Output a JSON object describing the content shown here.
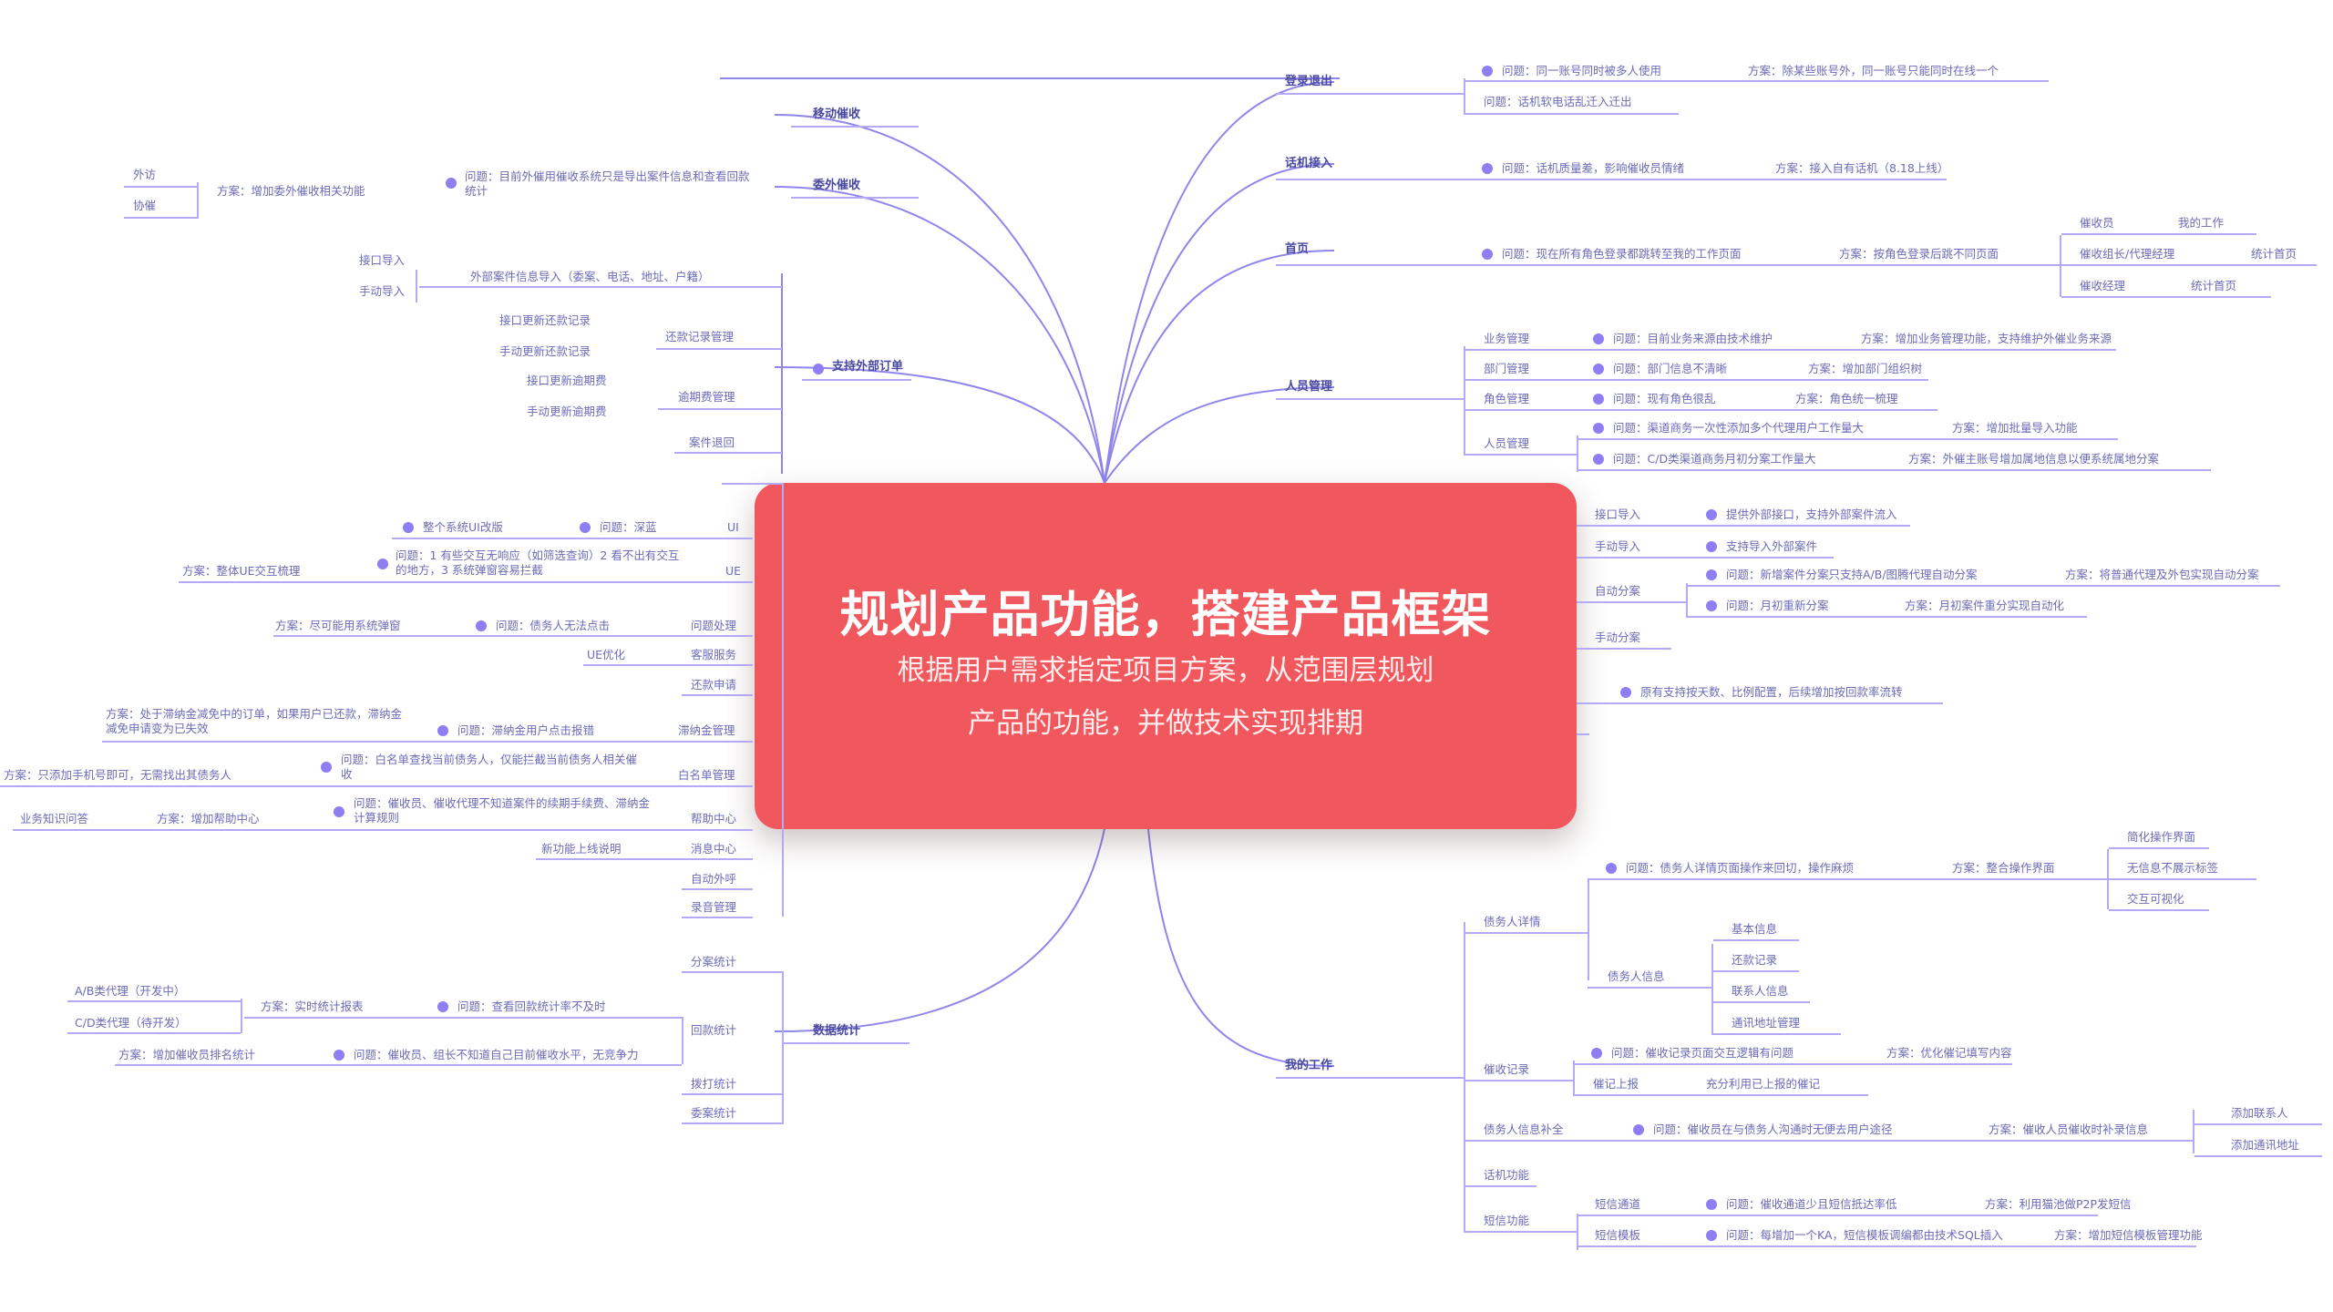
{
  "center": {
    "title": "规划产品功能，搭建产品框架",
    "subtitle_line1": "根据用户需求指定项目方案，从范围层规划",
    "subtitle_line2": "产品的功能，并做技术实现排期"
  },
  "left": {
    "mobile": "移动催收",
    "outsource": "委外催收",
    "outsource_problem": "问题：目前外催用催收系统只是导出案件信息和查看回款统计",
    "outsource_solution": "方案：增加委外催收相关功能",
    "visit": "外访",
    "assist": "协催",
    "external_order": "支持外部订单",
    "api_import": "接口导入",
    "manual_import": "手动导入",
    "case_import": "外部案件信息导入（委案、电话、地址、户籍）",
    "api_repay": "接口更新还款记录",
    "manual_repay": "手动更新还款记录",
    "repay_mgmt": "还款记录管理",
    "api_overdue": "接口更新逾期费",
    "manual_overdue": "手动更新逾期费",
    "overdue_mgmt": "逾期费管理",
    "case_return": "案件退回",
    "ui_revamp": "整个系统UI改版",
    "ui_problem": "问题：深蓝",
    "ui1": "UI",
    "ue_problem": "问题：1 有些交互无响应（如筛选查询）2 看不出有交互的地方，3 系统弹窗容易拦截",
    "ue_solution": "方案：整体UE交互梳理",
    "ue": "UE",
    "dispute_solution": "方案：尽可能用系统弹窗",
    "dispute_problem": "问题：债务人无法点击",
    "issue": "问题处理",
    "ue_opt": "UE优化",
    "cs": "客服服务",
    "repay_apply": "还款申请",
    "fee_solution": "方案：处于滞纳金减免中的订单，如果用户已还款，滞纳金减免申请变为已失效",
    "fee_problem": "问题：滞纳金用户点击报错",
    "fee_mgmt": "滞纳金管理",
    "white_solution": "方案：只添加手机号即可，无需找出其债务人",
    "white_problem": "问题：白名单查找当前债务人，仅能拦截当前债务人相关催收",
    "whitelist": "白名单管理",
    "kb": "业务知识问答",
    "help_solution": "方案：增加帮助中心",
    "help_problem": "问题：催收员、催收代理不知道案件的续期手续费、滞纳金计算规则",
    "help": "帮助中心",
    "newfeat": "新功能上线说明",
    "msg": "消息中心",
    "autocall": "自动外呼",
    "record": "录音管理",
    "datastat": "数据统计",
    "assign_stat": "分案统计",
    "ab": "A/B类代理（开发中）",
    "cd": "C/D类代理（待开发）",
    "realtime": "方案：实时统计报表",
    "refund_problem": "问题：查看回款统计率不及时",
    "refund_stat": "回款统计",
    "rank_solution": "方案：增加催收员排名统计",
    "rank_problem": "问题：催收员、组长不知道自己目前催收水平，无竞争力",
    "call_stat": "拨打统计",
    "commission_stat": "委案统计"
  },
  "right": {
    "login": "登录退出",
    "login_p1": "问题：同一账号同时被多人使用",
    "login_s1": "方案：除某些账号外，同一账号只能同时在线一个",
    "login_p2": "问题：话机软电话乱迁入迁出",
    "phone": "话机接入",
    "phone_p": "问题：话机质量差，影响催收员情绪",
    "phone_s": "方案：接入自有话机（8.18上线）",
    "home": "首页",
    "home_p": "问题：现在所有角色登录都跳转至我的工作页面",
    "home_s": "方案：按角色登录后跳不同页面",
    "r_collector": "催收员",
    "r_collector_v": "我的工作",
    "r_leader": "催收组长/代理经理",
    "r_leader_v": "统计首页",
    "r_manager": "催收经理",
    "r_manager_v": "统计首页",
    "staff": "人员管理",
    "biz": "业务管理",
    "biz_p": "问题：目前业务来源由技术维护",
    "biz_s": "方案：增加业务管理功能，支持维护外催业务来源",
    "dept": "部门管理",
    "dept_p": "问题：部门信息不清晰",
    "dept_s": "方案：增加部门组织树",
    "role": "角色管理",
    "role_p": "问题：现有角色很乱",
    "role_s": "方案：角色统一梳理",
    "people": "人员管理",
    "people_p1": "问题：渠道商务一次性添加多个代理用户工作量大",
    "people_s1": "方案：增加批量导入功能",
    "people_p2": "问题：C/D类渠道商务月初分案工作量大",
    "people_s2": "方案：外催主账号增加属地信息以便系统属地分案",
    "api_imp": "接口导入",
    "api_imp_v": "提供外部接口，支持外部案件流入",
    "man_imp": "手动导入",
    "man_imp_v": "支持导入外部案件",
    "auto_assign": "自动分案",
    "auto_p1": "问题：新增案件分案只支持A/B/图腾代理自动分案",
    "auto_s1": "方案：将普通代理及外包实现自动分案",
    "auto_p2": "问题：月初重新分案",
    "auto_s2": "方案：月初案件重分实现自动化",
    "manual_assign": "手动分案",
    "dpd_note": "原有支持按天数、比例配置，后续增加按回款率流转",
    "mywork": "我的工作",
    "debtor": "债务人详情",
    "debtor_p": "问题：债务人详情页面操作来回切，操作麻烦",
    "debtor_s": "方案：整合操作界面",
    "simplify": "简化操作界面",
    "nolabel": "无信息不展示标签",
    "visual": "交互可视化",
    "debtor_info": "债务人信息",
    "basic": "基本信息",
    "repay_rec": "还款记录",
    "contact": "联系人信息",
    "addr": "通讯地址管理",
    "collect_rec": "催收记录",
    "cr_p": "问题：催收记录页面交互逻辑有问题",
    "cr_s": "方案：优化催记填写内容",
    "upload": "催记上报",
    "upload_v": "充分利用已上报的催记",
    "supplement": "债务人信息补全",
    "sup_p": "问题：催收员在与债务人沟通时无便去用户途径",
    "sup_s": "方案：催收人员催收时补录信息",
    "add_contact": "添加联系人",
    "add_addr": "添加通讯地址",
    "phone_func": "话机功能",
    "sms": "短信功能",
    "sms_ch": "短信通道",
    "sms_ch_p": "问题：催收通道少且短信抵达率低",
    "sms_ch_s": "方案：利用猫池做P2P发短信",
    "sms_tpl": "短信模板",
    "sms_tpl_p": "问题：每增加一个KA，短信模板调编都由技术SQL插入",
    "sms_tpl_s": "方案：增加短信模板管理功能"
  }
}
